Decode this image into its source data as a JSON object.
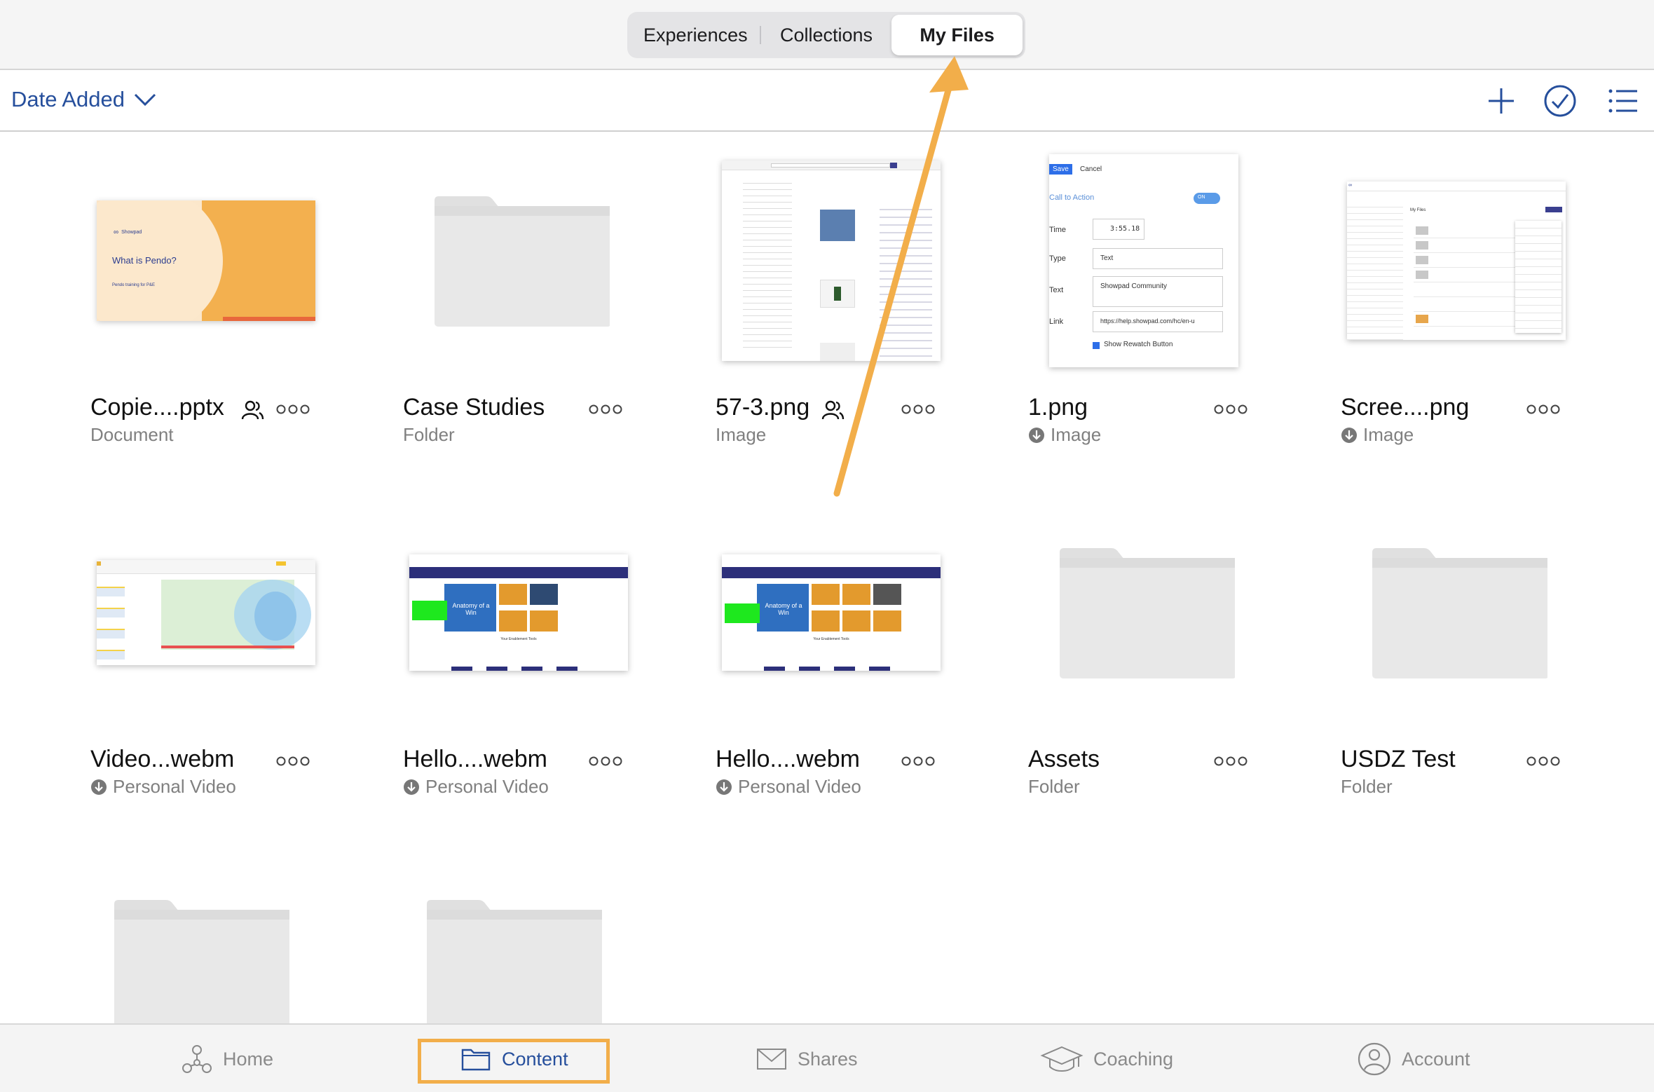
{
  "segmented": {
    "tabs": [
      "Experiences",
      "Collections",
      "My Files"
    ],
    "active": "My Files"
  },
  "toolbar": {
    "sort_label": "Date Added"
  },
  "items": [
    {
      "title": "Copie....pptx",
      "subtitle": "Document",
      "shared": true,
      "downloaded": false
    },
    {
      "title": "Case Studies",
      "subtitle": "Folder",
      "shared": false,
      "downloaded": false
    },
    {
      "title": "57-3.png",
      "subtitle": "Image",
      "shared": true,
      "downloaded": false
    },
    {
      "title": "1.png",
      "subtitle": "Image",
      "shared": false,
      "downloaded": true
    },
    {
      "title": "Scree....png",
      "subtitle": "Image",
      "shared": false,
      "downloaded": true
    },
    {
      "title": "Video...webm",
      "subtitle": "Personal Video",
      "shared": false,
      "downloaded": true
    },
    {
      "title": "Hello....webm",
      "subtitle": "Personal Video",
      "shared": false,
      "downloaded": true
    },
    {
      "title": "Hello....webm",
      "subtitle": "Personal Video",
      "shared": false,
      "downloaded": true
    },
    {
      "title": "Assets",
      "subtitle": "Folder",
      "shared": false,
      "downloaded": false
    },
    {
      "title": "USDZ Test",
      "subtitle": "Folder",
      "shared": false,
      "downloaded": false
    }
  ],
  "thumbs": {
    "pptx": {
      "brand": "Showpad",
      "heading": "What is Pendo?",
      "sub": "Pendo training for P&E"
    },
    "form": {
      "save": "Save",
      "cancel": "Cancel",
      "cta": "Call to Action",
      "toggle": "ON",
      "time_label": "Time",
      "time_value": "3:55.18",
      "type_label": "Type",
      "type_value": "Text",
      "text_label": "Text",
      "text_value": "Showpad Community",
      "link_label": "Link",
      "link_value": "https://help.showpad.com/hc/en-u",
      "rewatch": "Show Rewatch Button"
    },
    "myfiles": "My Files",
    "anatomy": "Anatomy of a Win",
    "tools": "Your Enablement Tools"
  },
  "tabbar": {
    "tabs": [
      "Home",
      "Content",
      "Shares",
      "Coaching",
      "Account"
    ],
    "active": "Content"
  },
  "colors": {
    "accent": "#264f9c",
    "highlight": "#f2ae4a",
    "folder": "#e6e6e6"
  }
}
